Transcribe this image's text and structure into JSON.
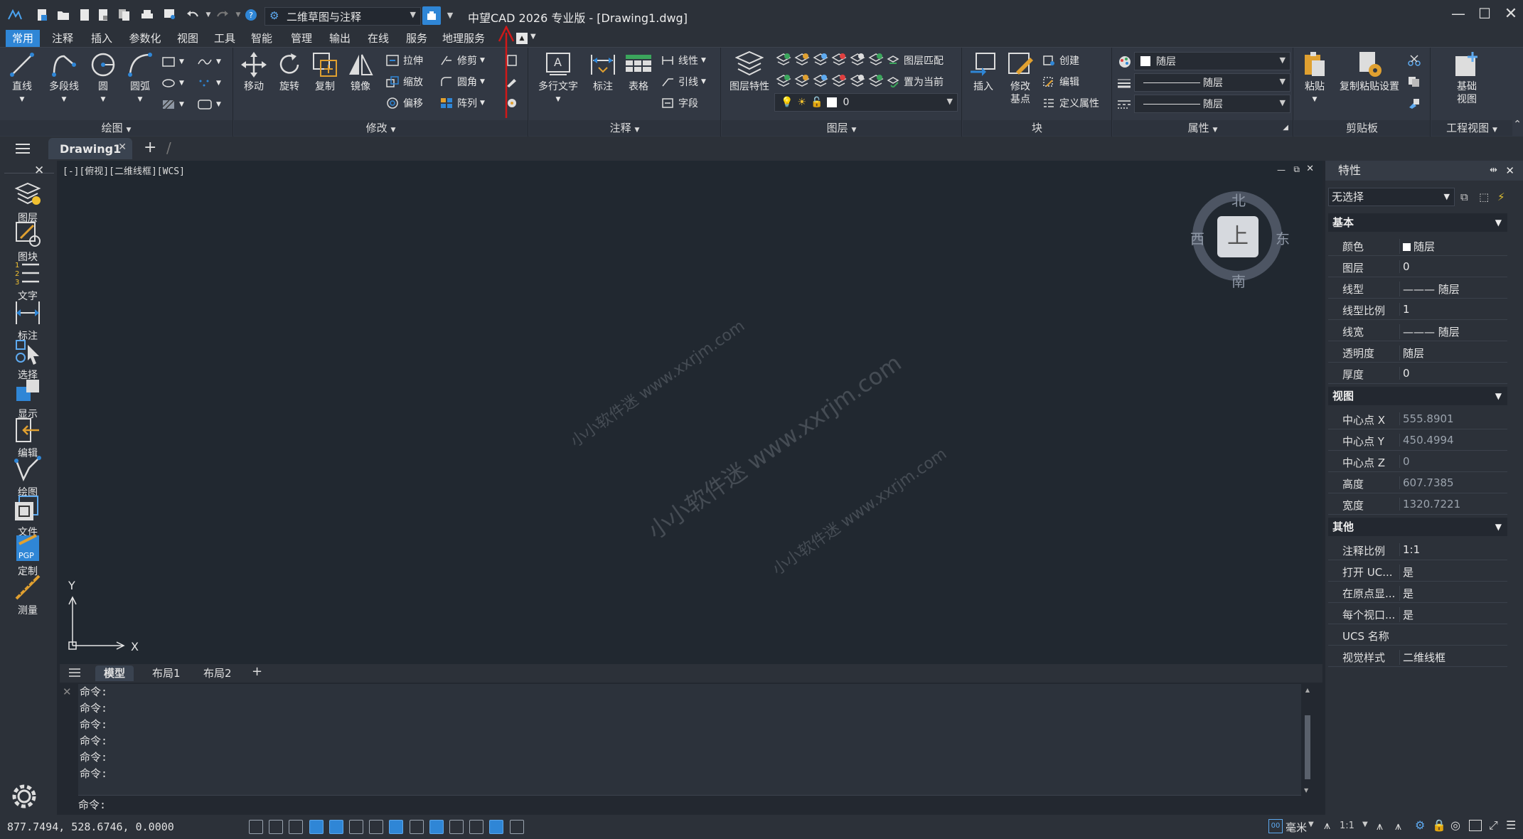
{
  "app": {
    "title": "中望CAD 2026 专业版 - [Drawing1.dwg]",
    "workspace": "二维草图与注释"
  },
  "menu": [
    "常用",
    "注释",
    "插入",
    "参数化",
    "视图",
    "工具",
    "智能",
    "管理",
    "输出",
    "在线",
    "服务",
    "地理服务"
  ],
  "ribbon": {
    "draw": {
      "label": "绘图",
      "items": [
        "直线",
        "多段线",
        "圆",
        "圆弧"
      ]
    },
    "modify": {
      "label": "修改",
      "big": [
        "移动",
        "旋转",
        "复制",
        "镜像"
      ],
      "small": [
        "拉伸",
        "缩放",
        "偏移",
        "修剪",
        "圆角",
        "阵列"
      ]
    },
    "annotate": {
      "label": "注释",
      "items": [
        "多行文字",
        "标注",
        "表格"
      ],
      "small": [
        "线性",
        "引线",
        "字段"
      ]
    },
    "layer": {
      "label": "图层",
      "big": "图层特性",
      "match": "图层匹配",
      "set_current": "置为当前",
      "current_layer": "0"
    },
    "block": {
      "label": "块",
      "insert": "插入",
      "edit_base_1": "修改",
      "edit_base_2": "基点",
      "create": "创建",
      "edit": "编辑",
      "define_attr": "定义属性"
    },
    "props": {
      "label": "属性",
      "color": "随层",
      "linetype": "随层",
      "lineweight": "随层"
    },
    "clipboard": {
      "label": "剪贴板",
      "paste": "粘贴",
      "paste_settings": "复制粘贴设置"
    },
    "projview": {
      "label": "工程视图",
      "base_1": "基础",
      "base_2": "视图"
    }
  },
  "doc_tab": "Drawing1",
  "left_tools": [
    "图层",
    "图块",
    "文字",
    "标注",
    "选择",
    "显示",
    "编辑",
    "绘图",
    "文件",
    "定制",
    "测量"
  ],
  "viewport": {
    "label": "[-][俯视][二维线框][WCS]",
    "compass": {
      "n": "北",
      "s": "南",
      "e": "东",
      "w": "西",
      "top": "上"
    },
    "ucs_x": "X",
    "ucs_y": "Y",
    "watermark": "小小软件迷 www.xxrjm.com"
  },
  "layout_tabs": [
    "模型",
    "布局1",
    "布局2"
  ],
  "command": {
    "history": [
      "命令:",
      "命令:",
      "命令:",
      "命令:",
      "命令:",
      "命令:"
    ],
    "prompt": "命令:"
  },
  "status": {
    "coords": "877.7494, 528.6746, 0.0000",
    "units": "毫米",
    "scale": "1:1"
  },
  "properties": {
    "title": "特性",
    "selection": "无选择",
    "sections": [
      {
        "name": "基本",
        "rows": [
          {
            "k": "颜色",
            "v": "随层"
          },
          {
            "k": "图层",
            "v": "0"
          },
          {
            "k": "线型",
            "v": "——— 随层"
          },
          {
            "k": "线型比例",
            "v": "1"
          },
          {
            "k": "线宽",
            "v": "——— 随层"
          },
          {
            "k": "透明度",
            "v": "随层"
          },
          {
            "k": "厚度",
            "v": "0"
          }
        ]
      },
      {
        "name": "视图",
        "rows": [
          {
            "k": "中心点 X",
            "v": "555.8901"
          },
          {
            "k": "中心点 Y",
            "v": "450.4994"
          },
          {
            "k": "中心点 Z",
            "v": "0"
          },
          {
            "k": "高度",
            "v": "607.7385"
          },
          {
            "k": "宽度",
            "v": "1320.7221"
          }
        ]
      },
      {
        "name": "其他",
        "rows": [
          {
            "k": "注释比例",
            "v": "1:1"
          },
          {
            "k": "打开 UC...",
            "v": "是"
          },
          {
            "k": "在原点显...",
            "v": "是"
          },
          {
            "k": "每个视口...",
            "v": "是"
          },
          {
            "k": "UCS 名称",
            "v": ""
          },
          {
            "k": "视觉样式",
            "v": "二维线框"
          }
        ]
      }
    ]
  },
  "colors": {
    "accent": "#2f86d6",
    "canvas": "#212830",
    "panel": "#323843"
  }
}
